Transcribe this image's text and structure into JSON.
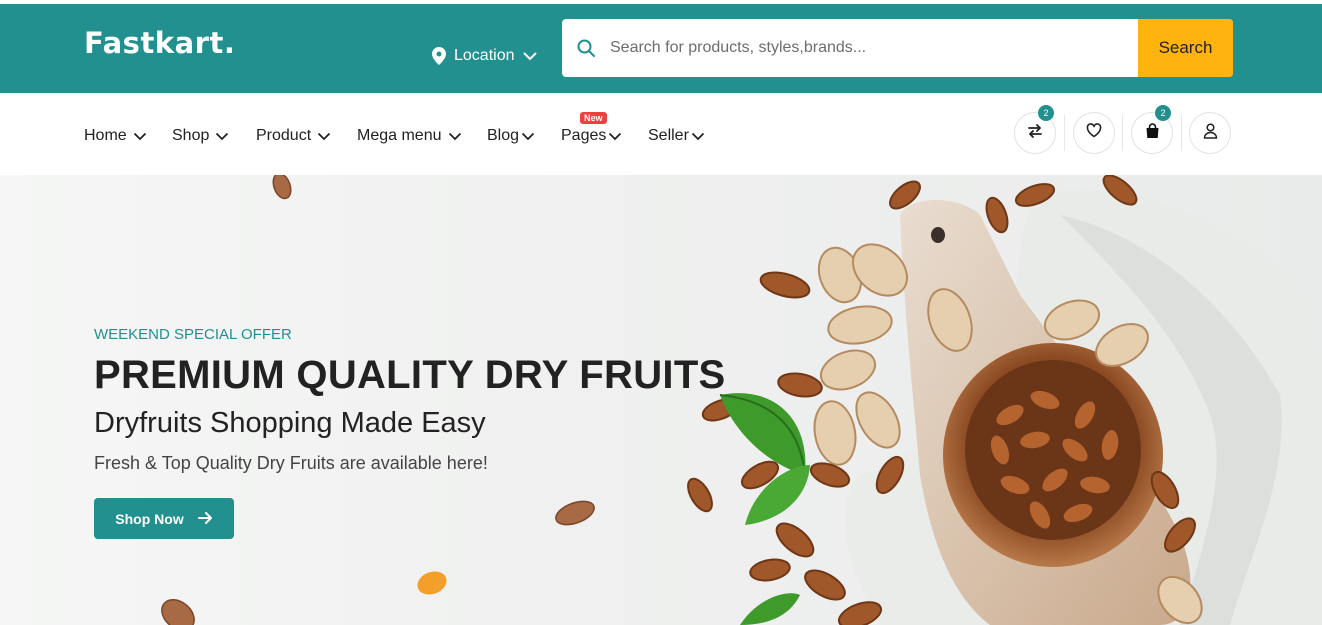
{
  "header": {
    "logo": "Fastkart.",
    "location_label": "Location",
    "search": {
      "placeholder": "Search for products, styles,brands...",
      "button_label": "Search"
    }
  },
  "nav": {
    "items": [
      {
        "label": "Home"
      },
      {
        "label": "Shop"
      },
      {
        "label": "Product"
      },
      {
        "label": "Mega menu"
      },
      {
        "label": "Blog"
      },
      {
        "label": "Pages",
        "badge": "New"
      },
      {
        "label": "Seller"
      }
    ],
    "compare_count": "2",
    "cart_count": "2"
  },
  "hero": {
    "tagline": "WEEKEND SPECIAL OFFER",
    "headline": "PREMIUM QUALITY DRY FRUITS",
    "subheadline": "Dryfruits Shopping Made Easy",
    "description": "Fresh & Top Quality Dry Fruits are available here!",
    "cta_label": "Shop Now"
  },
  "colors": {
    "primary": "#22908f",
    "accent": "#ffb30f",
    "badge": "#ef3f3e"
  },
  "icons": [
    "location-pin-icon",
    "chevron-down-icon",
    "search-icon",
    "compare-icon",
    "heart-icon",
    "shopping-bag-icon",
    "user-icon",
    "arrow-right-icon"
  ]
}
